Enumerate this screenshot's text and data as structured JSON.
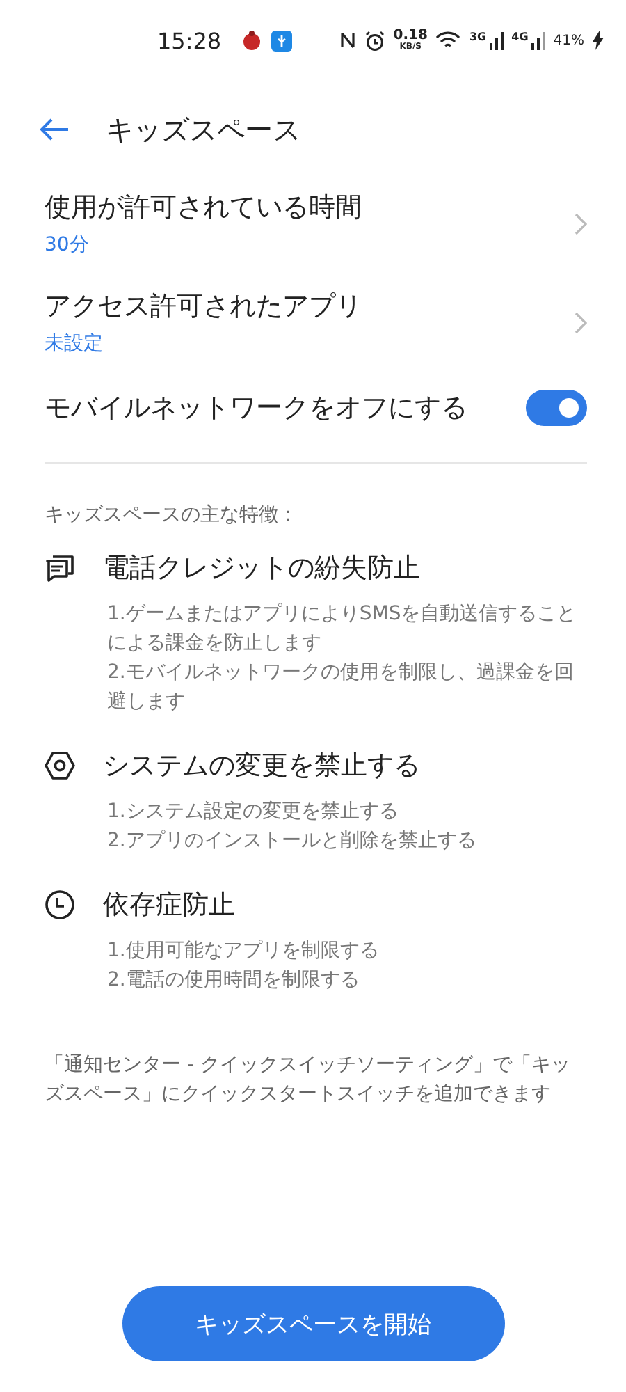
{
  "status_bar": {
    "time": "15:28",
    "speed": "0.18",
    "speed_unit": "KB/S",
    "net_1": "3G",
    "net_2": "4G",
    "battery": "41%"
  },
  "header": {
    "title": "キッズスペース"
  },
  "settings": [
    {
      "kind": "link",
      "label": "使用が許可されている時間",
      "value": "30分"
    },
    {
      "kind": "link",
      "label": "アクセス許可されたアプリ",
      "value": "未設定"
    },
    {
      "kind": "switch",
      "label": "モバイルネットワークをオフにする",
      "on": true
    }
  ],
  "features_heading": "キッズスペースの主な特徴：",
  "features": [
    {
      "kind": "chat",
      "title": "電話クレジットの紛失防止",
      "lines": [
        "1.ゲームまたはアプリによりSMSを自動送信することによる課金を防止します",
        "2.モバイルネットワークの使用を制限し、過課金を回避します"
      ]
    },
    {
      "kind": "nut",
      "title": "システムの変更を禁止する",
      "lines": [
        "1.システム設定の変更を禁止する",
        "2.アプリのインストールと削除を禁止する"
      ]
    },
    {
      "kind": "clock",
      "title": "依存症防止",
      "lines": [
        "1.使用可能なアプリを制限する",
        "2.電話の使用時間を制限する"
      ]
    }
  ],
  "note": "「通知センター - クイックスイッチソーティング」で「キッズスペース」にクイックスタートスイッチを追加できます",
  "start_button": "キッズスペースを開始"
}
